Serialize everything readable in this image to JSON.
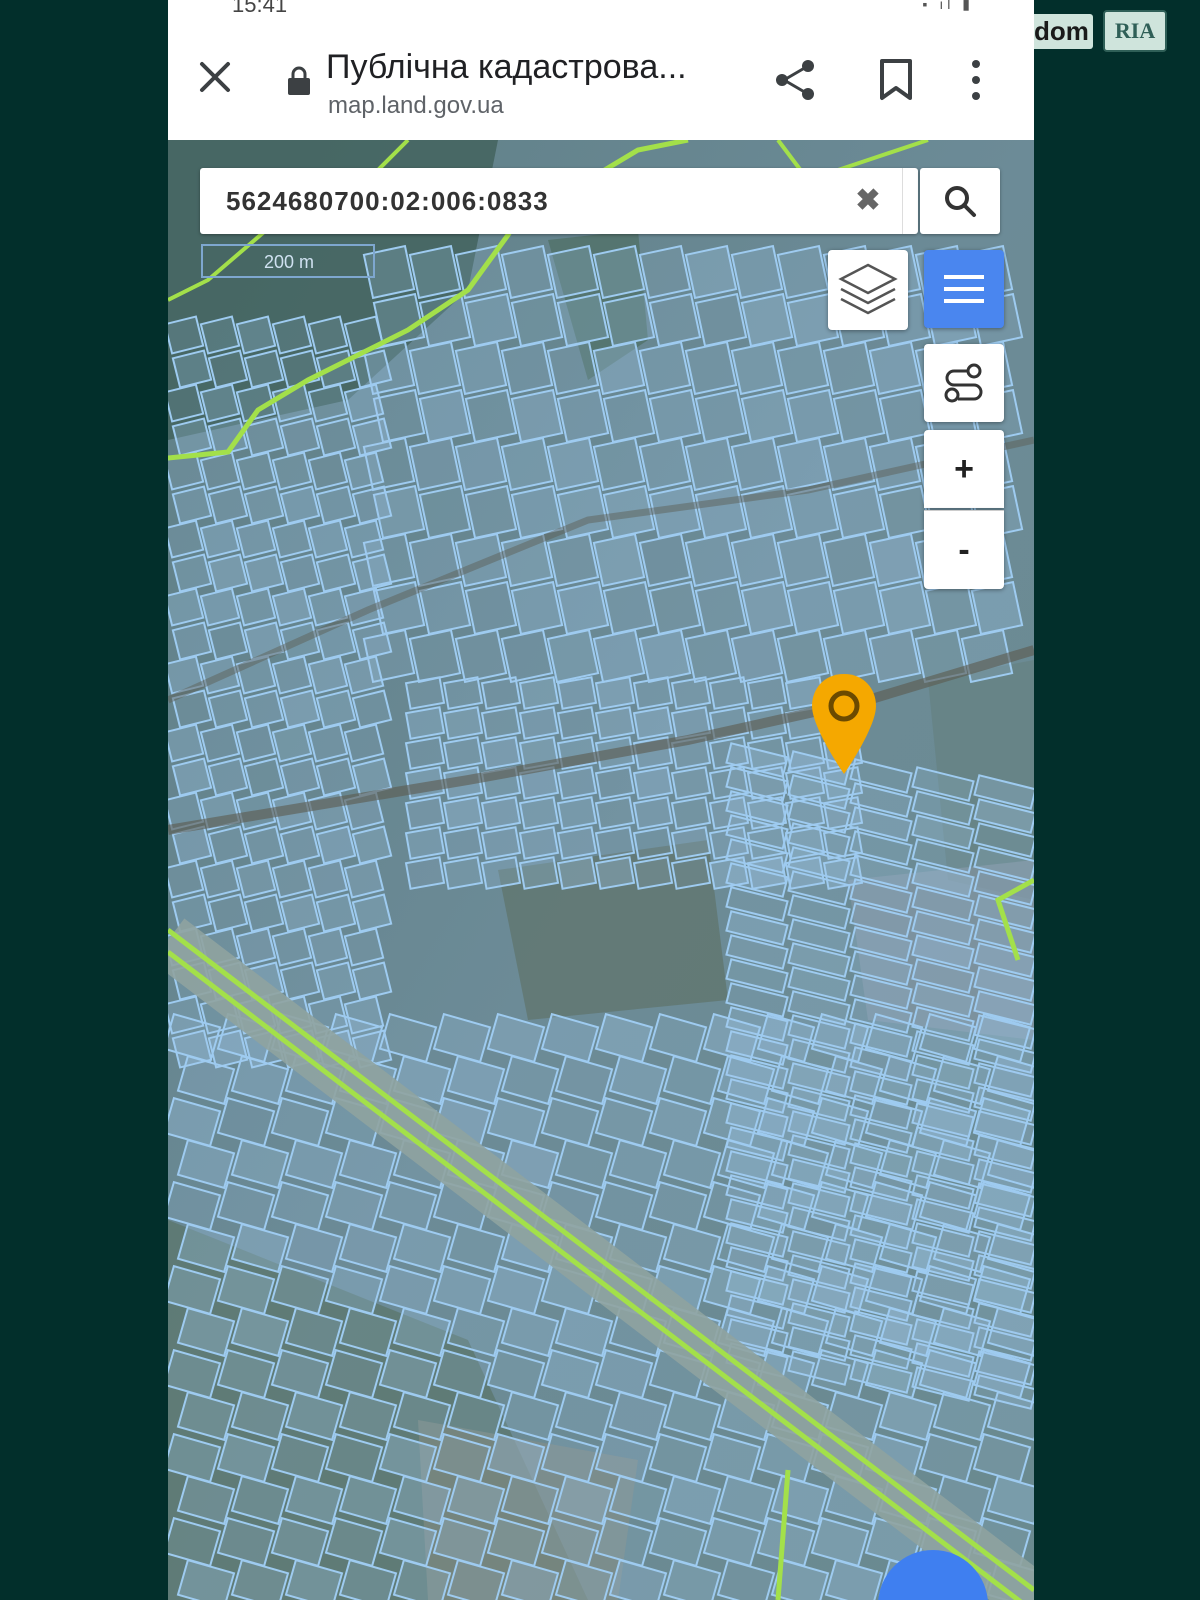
{
  "watermark": {
    "text": "dom",
    "badge": "RIA"
  },
  "statusbar": {
    "time": "15:41",
    "icons": "⊙⊙⊙ ·",
    "right_icons": "▪ ıl ▮"
  },
  "browser": {
    "title": "Публічна кадастрова...",
    "url": "map.land.gov.ua",
    "close_icon": "close-icon",
    "lock_icon": "lock-icon",
    "share_icon": "share-icon",
    "bookmark_icon": "bookmark-icon",
    "more_icon": "more-vert-icon"
  },
  "map": {
    "search_value": "5624680700:02:006:0833",
    "clear_symbol": "✖",
    "scale_label": "200 m",
    "zoom_in": "+",
    "zoom_out": "-",
    "colors": {
      "parcel_outline": "#9ecbf0",
      "boundary": "#a3e04a",
      "pin": "#f5a800",
      "menu_button": "#4a86ef"
    }
  }
}
